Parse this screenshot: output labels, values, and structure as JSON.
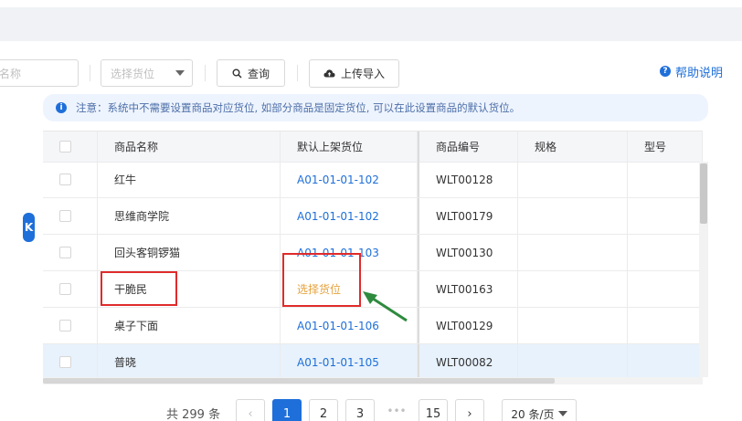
{
  "toolbar": {
    "name_input_placeholder": "名称",
    "location_select_placeholder": "选择货位",
    "query_label": "查询",
    "upload_label": "上传导入",
    "help_label": "帮助说明"
  },
  "notice": {
    "text": "注意：系统中不需要设置商品对应货位, 如部分商品是固定货位, 可以在此设置商品的默认货位。"
  },
  "table": {
    "columns": [
      "商品名称",
      "默认上架货位",
      "商品编号",
      "规格",
      "型号"
    ],
    "rows": [
      {
        "name": "红牛",
        "location": "A01-01-01-102",
        "code": "WLT00128",
        "spec": "",
        "model": ""
      },
      {
        "name": "思维商学院",
        "location": "A01-01-01-102",
        "code": "WLT00179",
        "spec": "",
        "model": ""
      },
      {
        "name": "回头客铜锣猫",
        "location": "A01-01-01-103",
        "code": "WLT00130",
        "spec": "",
        "model": ""
      },
      {
        "name": "干脆民",
        "location": "选择货位",
        "code": "WLT00163",
        "spec": "",
        "model": ""
      },
      {
        "name": "桌子下面",
        "location": "A01-01-01-106",
        "code": "WLT00129",
        "spec": "",
        "model": ""
      },
      {
        "name": "普晓",
        "location": "A01-01-01-105",
        "code": "WLT00082",
        "spec": "",
        "model": ""
      }
    ]
  },
  "pagination": {
    "total_label": "共 299 条",
    "pages": [
      "1",
      "2",
      "3",
      "•••",
      "15"
    ],
    "current_page": "1",
    "page_size_label": "20 条/页",
    "prev": "‹",
    "next": "›"
  },
  "sidebar_toggle": {
    "label": "K"
  },
  "colors": {
    "accent": "#1e6fd9",
    "warning": "#e6a23c",
    "highlight_row": "#e8f2fc",
    "annotation_red": "#e02b2b",
    "annotation_green": "#2e8b3e"
  }
}
